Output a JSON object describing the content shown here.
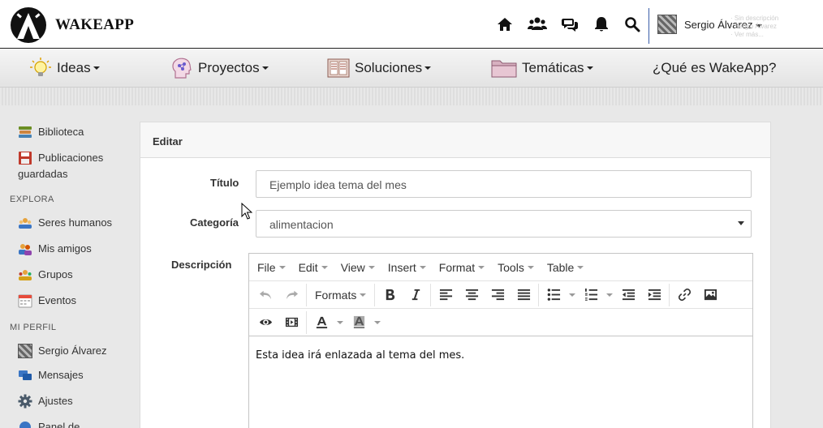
{
  "brand": {
    "name": "WAKEAPP"
  },
  "topbar": {
    "icons": [
      "home-icon",
      "users-icon",
      "comments-icon",
      "bell-icon",
      "search-icon"
    ],
    "user_name": "Sergio Álvarez",
    "faint_text": [
      "· Sin descripción",
      "· Sergio Álvarez",
      "· Ver más..."
    ]
  },
  "nav": {
    "items": [
      {
        "label": "Ideas",
        "icon": "lightbulb-icon",
        "dropdown": true
      },
      {
        "label": "Proyectos",
        "icon": "head-network-icon",
        "dropdown": true
      },
      {
        "label": "Soluciones",
        "icon": "document-icon",
        "dropdown": true
      },
      {
        "label": "Temáticas",
        "icon": "folder-icon",
        "dropdown": true
      },
      {
        "label": "¿Qué es WakeApp?",
        "icon": "",
        "dropdown": false
      }
    ]
  },
  "sidebar": {
    "biblioteca": "Biblioteca",
    "publicaciones_1": "Publicaciones",
    "publicaciones_2": "guardadas",
    "explora_heading": "EXPLORA",
    "seres_humanos": "Seres humanos",
    "mis_amigos": "Mis amigos",
    "grupos": "Grupos",
    "eventos": "Eventos",
    "perfil_heading": "MI PERFIL",
    "perfil_nombre": "Sergio Álvarez",
    "mensajes": "Mensajes",
    "ajustes": "Ajustes",
    "panel": "Panel de"
  },
  "panel": {
    "title": "Editar",
    "titulo_label": "Título",
    "titulo_value": "Ejemplo idea tema del mes",
    "categoria_label": "Categoría",
    "categoria_value": "alimentacion",
    "descripcion_label": "Descripción"
  },
  "editor": {
    "menus": [
      "File",
      "Edit",
      "View",
      "Insert",
      "Format",
      "Tools",
      "Table"
    ],
    "formats_label": "Formats",
    "content": "Esta idea irá enlazada al tema del mes."
  },
  "colors": {
    "accent_separator": "#3a5da8",
    "navbar_bg": "#eeeeee",
    "panel_bg": "#ffffff",
    "page_bg": "#e8e8e8"
  }
}
